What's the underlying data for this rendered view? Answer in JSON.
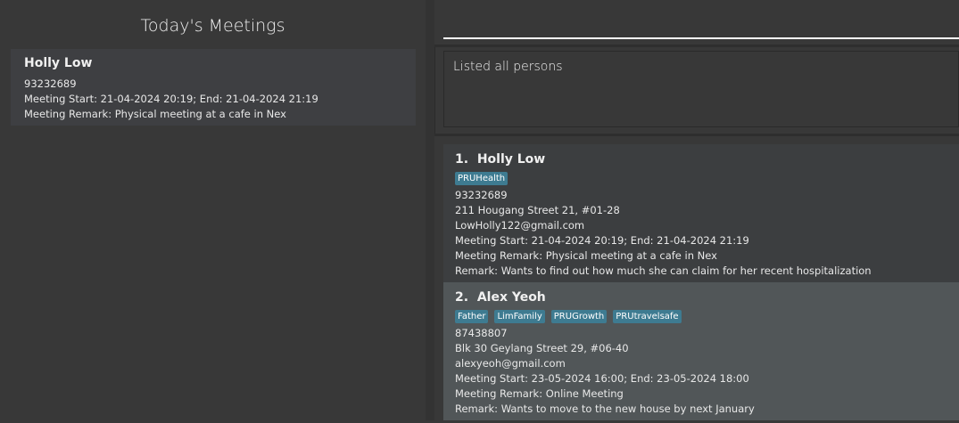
{
  "today": {
    "title": "Today's Meetings",
    "meetings": [
      {
        "name": "Holly Low",
        "phone": "93232689",
        "meeting": "Meeting Start: 21-04-2024 20:19; End: 21-04-2024 21:19",
        "meeting_remark": "Meeting Remark: Physical meeting at a cafe in Nex"
      }
    ]
  },
  "command": {
    "value": ""
  },
  "result": {
    "text": "Listed all persons"
  },
  "persons": [
    {
      "index": "1.",
      "name": "Holly Low",
      "tags": [
        "PRUHealth"
      ],
      "phone": "93232689",
      "address": "211 Hougang Street 21, #01-28",
      "email": "LowHolly122@gmail.com",
      "meeting": "Meeting Start: 21-04-2024 20:19; End: 21-04-2024 21:19",
      "meeting_remark": "Meeting Remark: Physical meeting at a cafe in Nex",
      "remark": "Remark: Wants to find out how much she can claim for her recent hospitalization"
    },
    {
      "index": "2.",
      "name": "Alex Yeoh",
      "tags": [
        "Father",
        "LimFamily",
        "PRUGrowth",
        "PRUtravelsafe"
      ],
      "phone": "87438807",
      "address": "Blk 30 Geylang Street 29, #06-40",
      "email": "alexyeoh@gmail.com",
      "meeting": "Meeting Start: 23-05-2024 16:00; End: 23-05-2024 18:00",
      "meeting_remark": "Meeting Remark: Online Meeting",
      "remark": "Remark: Wants to move to the new house by next January"
    }
  ],
  "colors": {
    "tag": "#3e7b91",
    "card_odd": "#3c3e40",
    "card_even": "#515658",
    "background": "#383838"
  }
}
